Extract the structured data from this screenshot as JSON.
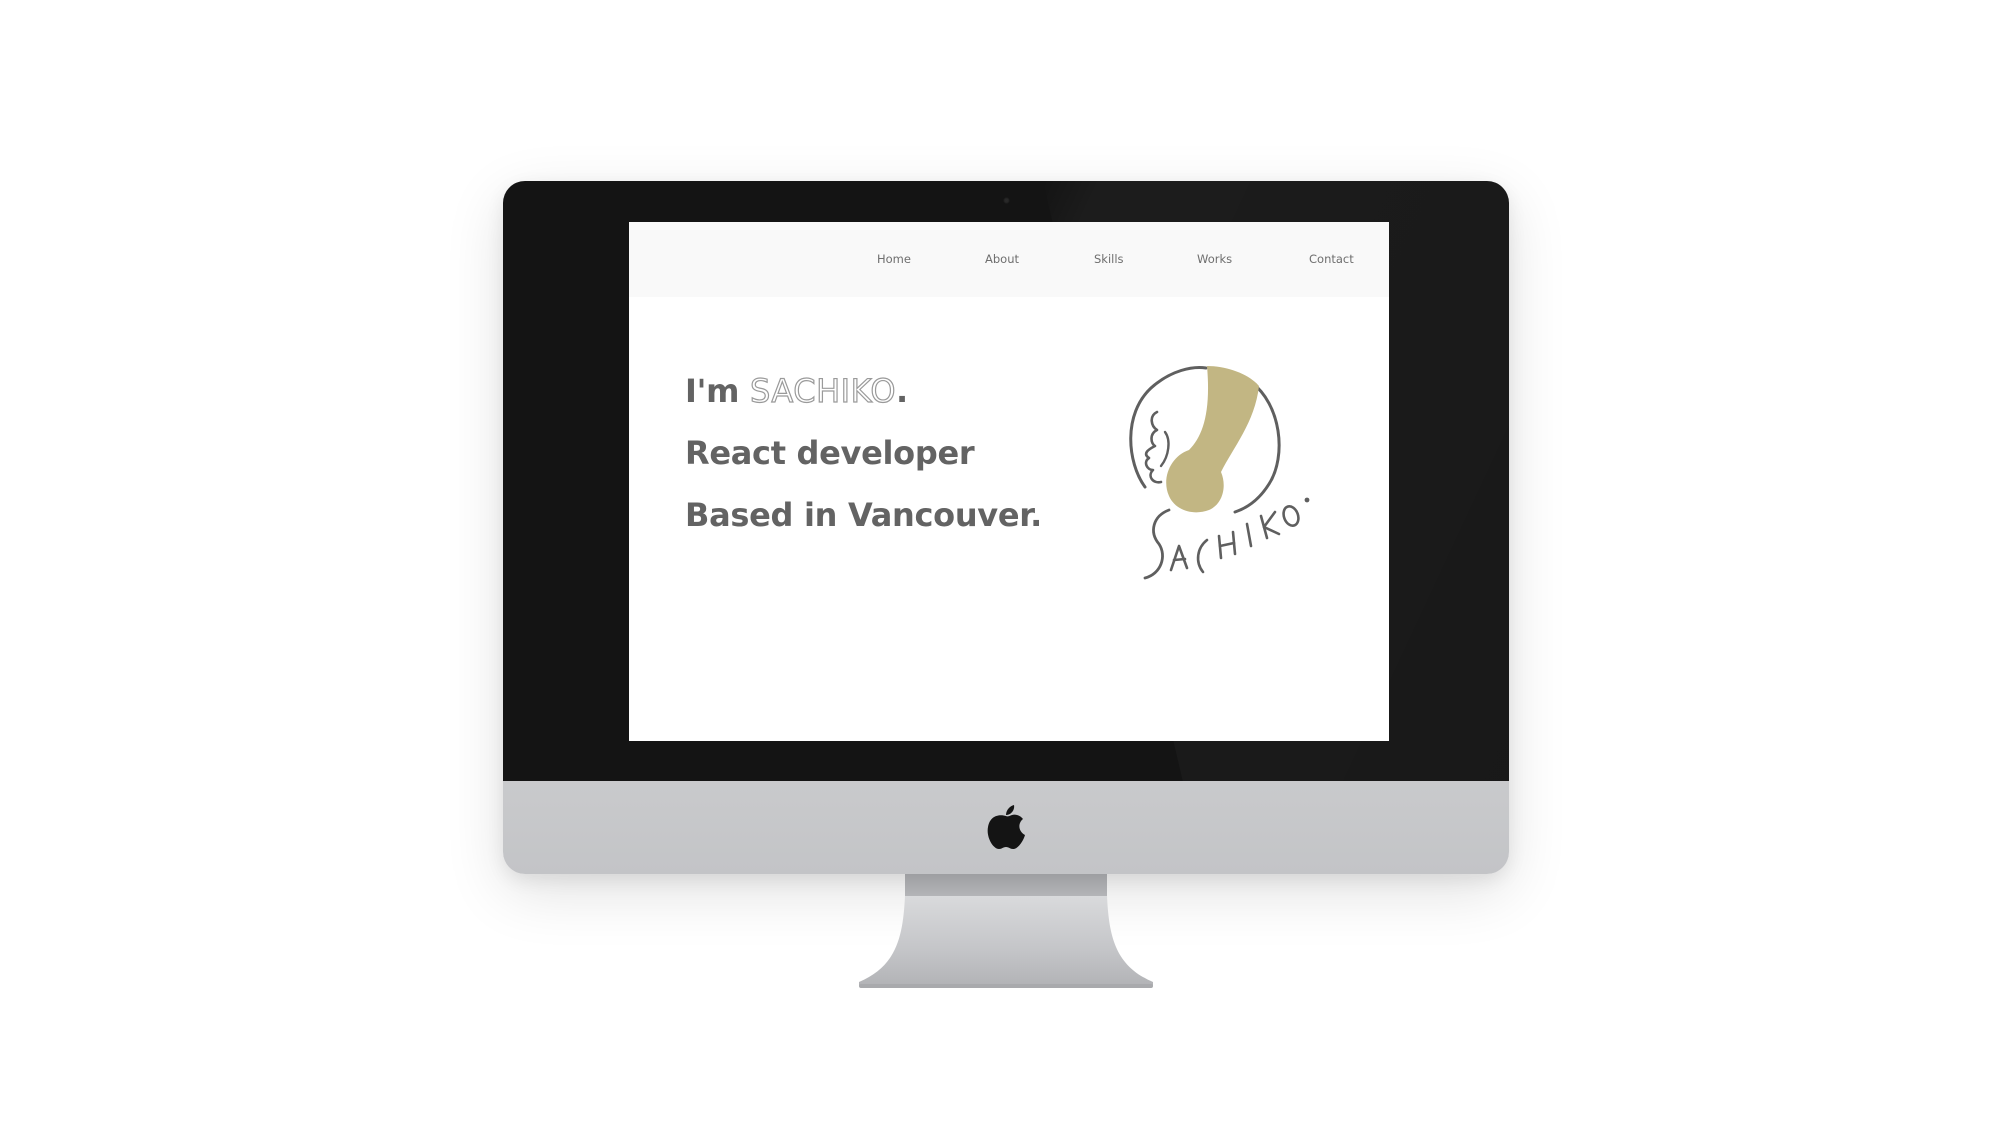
{
  "nav": {
    "home": "Home",
    "about": "About",
    "skills": "Skills",
    "works": "Works",
    "contact": "Contact"
  },
  "hero": {
    "greeting_prefix": "I'm ",
    "name": "SACHIKO",
    "greeting_suffix": ".",
    "line2": "React developer",
    "line3": "Based in Vancouver."
  },
  "logo": {
    "text": "SACHIKO."
  },
  "colors": {
    "accent": "#c2b683",
    "text": "#636363",
    "bezel": "#141414",
    "chin": "#c6c7ca"
  },
  "icons": {
    "device_logo": "apple-logo-icon",
    "brand": "headphones-portrait-logo"
  }
}
